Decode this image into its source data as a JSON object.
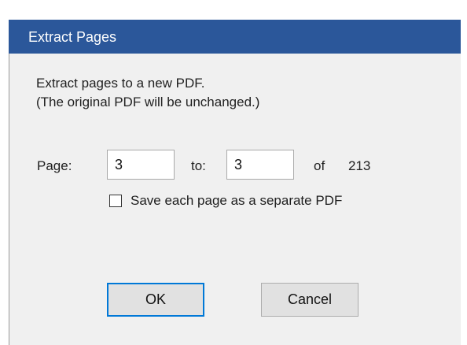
{
  "dialog": {
    "title": "Extract Pages",
    "description_line1": "Extract pages to a new PDF.",
    "description_line2": "(The original PDF will be unchanged.)"
  },
  "page_range": {
    "page_label": "Page:",
    "from_value": "3",
    "to_label": "to:",
    "to_value": "3",
    "of_label": "of",
    "total_pages": "213"
  },
  "options": {
    "separate_pdf_label": "Save each page as a separate PDF",
    "separate_pdf_checked": false
  },
  "buttons": {
    "ok_label": "OK",
    "cancel_label": "Cancel"
  },
  "colors": {
    "titlebar": "#2b579a",
    "dialog_background": "#f0f0f0",
    "default_button_border": "#0078d7"
  }
}
